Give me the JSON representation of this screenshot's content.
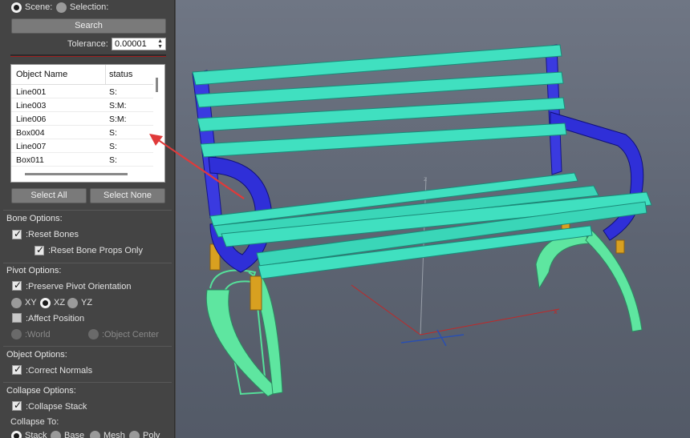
{
  "scope": {
    "scene_label": "Scene:",
    "selection_label": "Selection:",
    "selected": "Scene"
  },
  "search_button": "Search",
  "tolerance": {
    "label": "Tolerance:",
    "value": "0.00001"
  },
  "list": {
    "columns": [
      "Object Name",
      "status"
    ],
    "rows": [
      {
        "name": "Line001",
        "status": "S:"
      },
      {
        "name": "Line003",
        "status": "S:M:"
      },
      {
        "name": "Line006",
        "status": "S:M:"
      },
      {
        "name": "Box004",
        "status": "S:"
      },
      {
        "name": "Line007",
        "status": "S:"
      },
      {
        "name": "Box011",
        "status": "S:"
      }
    ]
  },
  "select_all": "Select All",
  "select_none": "Select None",
  "bone_options": {
    "title": "Bone Options:",
    "reset_bones": {
      "label": ":Reset Bones",
      "checked": true
    },
    "reset_bone_props_only": {
      "label": ":Reset Bone Props Only",
      "checked": true
    }
  },
  "pivot_options": {
    "title": "Pivot Options:",
    "preserve_orientation": {
      "label": ":Preserve Pivot Orientation",
      "checked": true
    },
    "planes": [
      "XY",
      "XZ",
      "YZ"
    ],
    "plane_selected": "XZ",
    "affect_position": {
      "label": ":Affect Position",
      "checked": false
    },
    "world_label": ":World",
    "object_center_label": ":Object Center"
  },
  "object_options": {
    "title": "Object Options:",
    "correct_normals": {
      "label": ":Correct Normals",
      "checked": true
    }
  },
  "collapse_options": {
    "title": "Collapse Options:",
    "collapse_stack": {
      "label": ":Collapse Stack",
      "checked": true
    },
    "collapse_to_label": "Collapse To:",
    "targets": [
      "Stack",
      "Base",
      "Mesh",
      "Poly"
    ],
    "target_selected": "Stack"
  },
  "viewport": {
    "bench_slat_color": "#40e0c0",
    "frame_color": "#2a2ad0",
    "leg_color": "#55e09a",
    "bolt_color": "#d8a020",
    "annotation_arrow_color": "#e03a3a"
  }
}
